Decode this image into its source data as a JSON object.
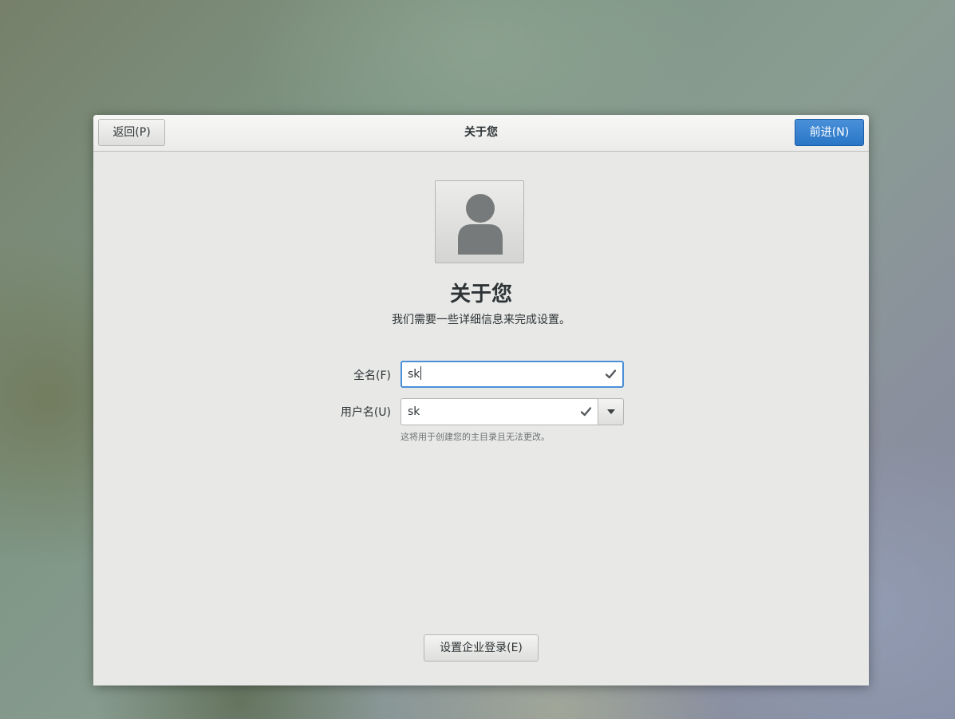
{
  "header": {
    "back_label": "返回(P)",
    "title": "关于您",
    "next_label": "前进(N)"
  },
  "main": {
    "avatar_icon": "user-avatar-icon",
    "title": "关于您",
    "subtitle": "我们需要一些详细信息来完成设置。",
    "fullname": {
      "label": "全名(F)",
      "value": "sk",
      "status_icon": "checkmark-icon"
    },
    "username": {
      "label": "用户名(U)",
      "value": "sk",
      "status_icon": "checkmark-icon",
      "dropdown_icon": "chevron-down-icon",
      "hint": "这将用于创建您的主目录且无法更改。"
    },
    "enterprise_login_label": "设置企业登录(E)"
  },
  "colors": {
    "accent": "#4a90d9",
    "window_bg": "#e8e8e7",
    "text": "#2e3436"
  }
}
